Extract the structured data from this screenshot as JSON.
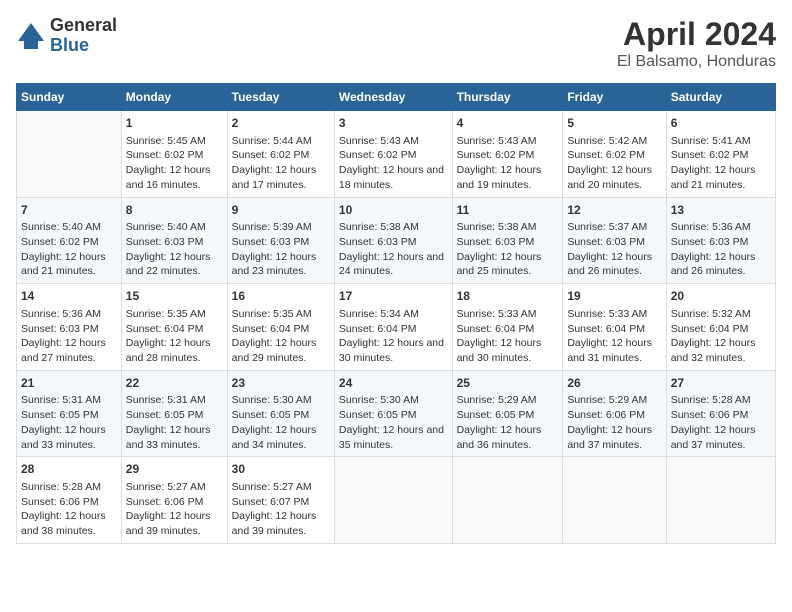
{
  "header": {
    "logo_general": "General",
    "logo_blue": "Blue",
    "month": "April 2024",
    "location": "El Balsamo, Honduras"
  },
  "days_of_week": [
    "Sunday",
    "Monday",
    "Tuesday",
    "Wednesday",
    "Thursday",
    "Friday",
    "Saturday"
  ],
  "weeks": [
    [
      {
        "day": "",
        "sunrise": "",
        "sunset": "",
        "daylight": ""
      },
      {
        "day": "1",
        "sunrise": "Sunrise: 5:45 AM",
        "sunset": "Sunset: 6:02 PM",
        "daylight": "Daylight: 12 hours and 16 minutes."
      },
      {
        "day": "2",
        "sunrise": "Sunrise: 5:44 AM",
        "sunset": "Sunset: 6:02 PM",
        "daylight": "Daylight: 12 hours and 17 minutes."
      },
      {
        "day": "3",
        "sunrise": "Sunrise: 5:43 AM",
        "sunset": "Sunset: 6:02 PM",
        "daylight": "Daylight: 12 hours and 18 minutes."
      },
      {
        "day": "4",
        "sunrise": "Sunrise: 5:43 AM",
        "sunset": "Sunset: 6:02 PM",
        "daylight": "Daylight: 12 hours and 19 minutes."
      },
      {
        "day": "5",
        "sunrise": "Sunrise: 5:42 AM",
        "sunset": "Sunset: 6:02 PM",
        "daylight": "Daylight: 12 hours and 20 minutes."
      },
      {
        "day": "6",
        "sunrise": "Sunrise: 5:41 AM",
        "sunset": "Sunset: 6:02 PM",
        "daylight": "Daylight: 12 hours and 21 minutes."
      }
    ],
    [
      {
        "day": "7",
        "sunrise": "Sunrise: 5:40 AM",
        "sunset": "Sunset: 6:02 PM",
        "daylight": "Daylight: 12 hours and 21 minutes."
      },
      {
        "day": "8",
        "sunrise": "Sunrise: 5:40 AM",
        "sunset": "Sunset: 6:03 PM",
        "daylight": "Daylight: 12 hours and 22 minutes."
      },
      {
        "day": "9",
        "sunrise": "Sunrise: 5:39 AM",
        "sunset": "Sunset: 6:03 PM",
        "daylight": "Daylight: 12 hours and 23 minutes."
      },
      {
        "day": "10",
        "sunrise": "Sunrise: 5:38 AM",
        "sunset": "Sunset: 6:03 PM",
        "daylight": "Daylight: 12 hours and 24 minutes."
      },
      {
        "day": "11",
        "sunrise": "Sunrise: 5:38 AM",
        "sunset": "Sunset: 6:03 PM",
        "daylight": "Daylight: 12 hours and 25 minutes."
      },
      {
        "day": "12",
        "sunrise": "Sunrise: 5:37 AM",
        "sunset": "Sunset: 6:03 PM",
        "daylight": "Daylight: 12 hours and 26 minutes."
      },
      {
        "day": "13",
        "sunrise": "Sunrise: 5:36 AM",
        "sunset": "Sunset: 6:03 PM",
        "daylight": "Daylight: 12 hours and 26 minutes."
      }
    ],
    [
      {
        "day": "14",
        "sunrise": "Sunrise: 5:36 AM",
        "sunset": "Sunset: 6:03 PM",
        "daylight": "Daylight: 12 hours and 27 minutes."
      },
      {
        "day": "15",
        "sunrise": "Sunrise: 5:35 AM",
        "sunset": "Sunset: 6:04 PM",
        "daylight": "Daylight: 12 hours and 28 minutes."
      },
      {
        "day": "16",
        "sunrise": "Sunrise: 5:35 AM",
        "sunset": "Sunset: 6:04 PM",
        "daylight": "Daylight: 12 hours and 29 minutes."
      },
      {
        "day": "17",
        "sunrise": "Sunrise: 5:34 AM",
        "sunset": "Sunset: 6:04 PM",
        "daylight": "Daylight: 12 hours and 30 minutes."
      },
      {
        "day": "18",
        "sunrise": "Sunrise: 5:33 AM",
        "sunset": "Sunset: 6:04 PM",
        "daylight": "Daylight: 12 hours and 30 minutes."
      },
      {
        "day": "19",
        "sunrise": "Sunrise: 5:33 AM",
        "sunset": "Sunset: 6:04 PM",
        "daylight": "Daylight: 12 hours and 31 minutes."
      },
      {
        "day": "20",
        "sunrise": "Sunrise: 5:32 AM",
        "sunset": "Sunset: 6:04 PM",
        "daylight": "Daylight: 12 hours and 32 minutes."
      }
    ],
    [
      {
        "day": "21",
        "sunrise": "Sunrise: 5:31 AM",
        "sunset": "Sunset: 6:05 PM",
        "daylight": "Daylight: 12 hours and 33 minutes."
      },
      {
        "day": "22",
        "sunrise": "Sunrise: 5:31 AM",
        "sunset": "Sunset: 6:05 PM",
        "daylight": "Daylight: 12 hours and 33 minutes."
      },
      {
        "day": "23",
        "sunrise": "Sunrise: 5:30 AM",
        "sunset": "Sunset: 6:05 PM",
        "daylight": "Daylight: 12 hours and 34 minutes."
      },
      {
        "day": "24",
        "sunrise": "Sunrise: 5:30 AM",
        "sunset": "Sunset: 6:05 PM",
        "daylight": "Daylight: 12 hours and 35 minutes."
      },
      {
        "day": "25",
        "sunrise": "Sunrise: 5:29 AM",
        "sunset": "Sunset: 6:05 PM",
        "daylight": "Daylight: 12 hours and 36 minutes."
      },
      {
        "day": "26",
        "sunrise": "Sunrise: 5:29 AM",
        "sunset": "Sunset: 6:06 PM",
        "daylight": "Daylight: 12 hours and 37 minutes."
      },
      {
        "day": "27",
        "sunrise": "Sunrise: 5:28 AM",
        "sunset": "Sunset: 6:06 PM",
        "daylight": "Daylight: 12 hours and 37 minutes."
      }
    ],
    [
      {
        "day": "28",
        "sunrise": "Sunrise: 5:28 AM",
        "sunset": "Sunset: 6:06 PM",
        "daylight": "Daylight: 12 hours and 38 minutes."
      },
      {
        "day": "29",
        "sunrise": "Sunrise: 5:27 AM",
        "sunset": "Sunset: 6:06 PM",
        "daylight": "Daylight: 12 hours and 39 minutes."
      },
      {
        "day": "30",
        "sunrise": "Sunrise: 5:27 AM",
        "sunset": "Sunset: 6:07 PM",
        "daylight": "Daylight: 12 hours and 39 minutes."
      },
      {
        "day": "",
        "sunrise": "",
        "sunset": "",
        "daylight": ""
      },
      {
        "day": "",
        "sunrise": "",
        "sunset": "",
        "daylight": ""
      },
      {
        "day": "",
        "sunrise": "",
        "sunset": "",
        "daylight": ""
      },
      {
        "day": "",
        "sunrise": "",
        "sunset": "",
        "daylight": ""
      }
    ]
  ]
}
